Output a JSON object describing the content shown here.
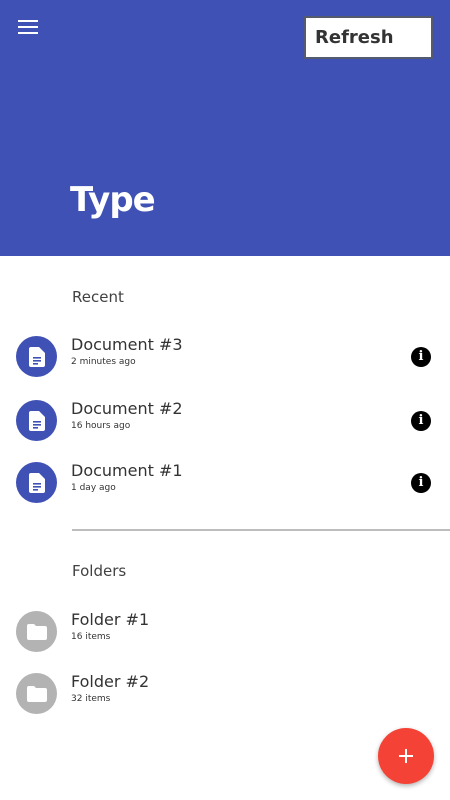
{
  "header": {
    "title": "Type",
    "refresh_label": "Refresh",
    "menu_icon": "hamburger-menu-icon",
    "background_color": "#3f51b5"
  },
  "recent": {
    "section_label": "Recent",
    "items": [
      {
        "title": "Document #3",
        "subtitle": "2 minutes ago",
        "icon": "document-icon"
      },
      {
        "title": "Document #2",
        "subtitle": "16 hours ago",
        "icon": "document-icon"
      },
      {
        "title": "Document #1",
        "subtitle": "1 day ago",
        "icon": "document-icon"
      }
    ],
    "info_icon": "info-icon"
  },
  "folders": {
    "section_label": "Folders",
    "items": [
      {
        "title": "Folder #1",
        "subtitle": "16 items",
        "icon": "folder-icon"
      },
      {
        "title": "Folder #2",
        "subtitle": "32 items",
        "icon": "folder-icon"
      }
    ]
  },
  "fab": {
    "icon": "plus-icon",
    "color": "#f44336"
  },
  "colors": {
    "accent": "#3f51b5",
    "folder_avatar": "#b3b3b3",
    "fab": "#f44336"
  }
}
